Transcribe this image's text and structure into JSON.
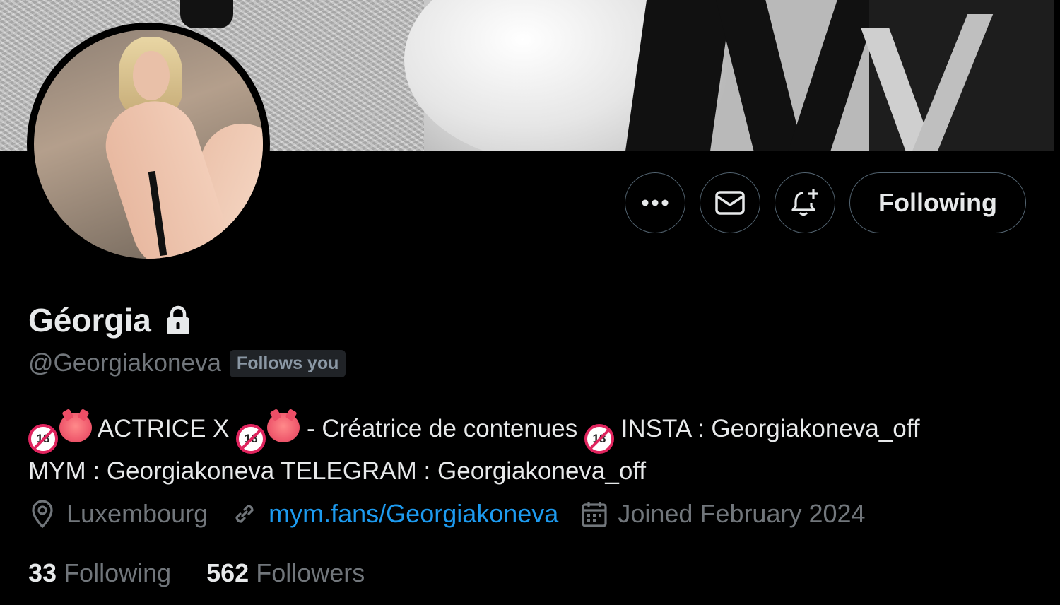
{
  "banner": {
    "description_icon": "profile-banner-image"
  },
  "avatar": {
    "icon": "profile-avatar-image"
  },
  "actions": {
    "more_icon": "more-dots-icon",
    "message_icon": "envelope-icon",
    "notify_icon": "bell-plus-icon",
    "following_label": "Following"
  },
  "profile": {
    "name": "Géorgia",
    "protected_icon": "lock-icon",
    "handle": "@Georgiakoneva",
    "follows_you": "Follows you"
  },
  "bio": {
    "part1": "ACTRICE X",
    "part2": "- Créatrice de contenues",
    "part3": "INSTA : Georgiakoneva_off",
    "line2": "MYM : Georgiakoneva TELEGRAM : Georgiakoneva_off",
    "emoji18": "18"
  },
  "meta": {
    "location": "Luxembourg",
    "location_icon": "location-pin-icon",
    "link": "mym.fans/Georgiakoneva",
    "link_icon": "link-icon",
    "joined": "Joined February 2024",
    "joined_icon": "calendar-icon"
  },
  "stats": {
    "following_count": "33",
    "following_label": "Following",
    "followers_count": "562",
    "followers_label": "Followers"
  }
}
